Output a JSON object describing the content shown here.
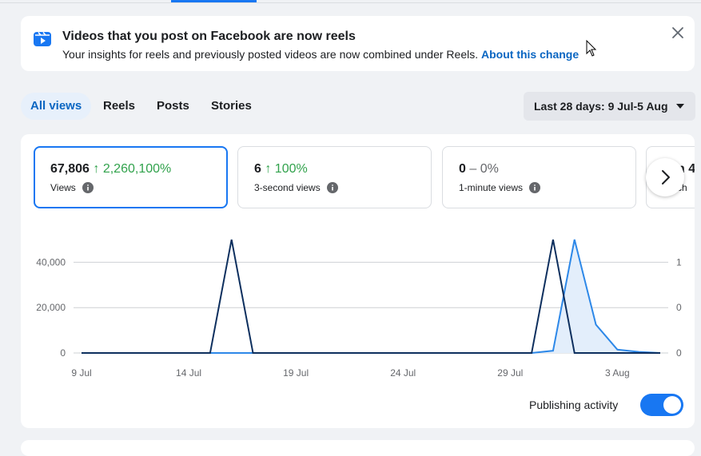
{
  "notice": {
    "title": "Videos that you post on Facebook are now reels",
    "body": "Your insights for reels and previously posted videos are now combined under Reels.",
    "link": "About this change"
  },
  "tabs": [
    "All views",
    "Reels",
    "Posts",
    "Stories"
  ],
  "date_range": "Last 28 days: 9 Jul-5 Aug",
  "metrics": [
    {
      "value": "67,806",
      "change": "↑ 2,260,100%",
      "label": "Views"
    },
    {
      "value": "6",
      "change": "↑ 100%",
      "label": "3-second views"
    },
    {
      "value": "0",
      "change": "– 0%",
      "label": "1-minute views"
    },
    {
      "value": "n 4",
      "label": "ch"
    }
  ],
  "toggle_label": "Publishing activity",
  "toggle_on": true,
  "colors": {
    "accent": "#1877f2",
    "link": "#0a66c2",
    "up": "#31a24c",
    "series_dark": "#0d2f5e",
    "series_light": "#2d88e8"
  },
  "chart_data": {
    "type": "line",
    "x_labels": [
      "9 Jul",
      "14 Jul",
      "19 Jul",
      "24 Jul",
      "29 Jul",
      "3 Aug"
    ],
    "left_ticks": [
      "0",
      "20,000",
      "40,000"
    ],
    "right_ticks": [
      "0",
      "0",
      "1"
    ],
    "ylim_left": [
      0,
      50000
    ],
    "ylim_right": [
      0,
      1.25
    ],
    "series": [
      {
        "axis": "left",
        "style": "area",
        "values": [
          0,
          0,
          0,
          0,
          0,
          0,
          0,
          0,
          0,
          0,
          0,
          0,
          0,
          0,
          0,
          0,
          0,
          0,
          0,
          0,
          0,
          0,
          1000,
          50000,
          12500,
          1500,
          500,
          0
        ]
      },
      {
        "axis": "right",
        "style": "line",
        "values": [
          0,
          0,
          0,
          0,
          0,
          0,
          0,
          1.25,
          0,
          0,
          0,
          0,
          0,
          0,
          0,
          0,
          0,
          0,
          0,
          0,
          0,
          0,
          1.25,
          0,
          0,
          0,
          0,
          0
        ]
      }
    ]
  }
}
